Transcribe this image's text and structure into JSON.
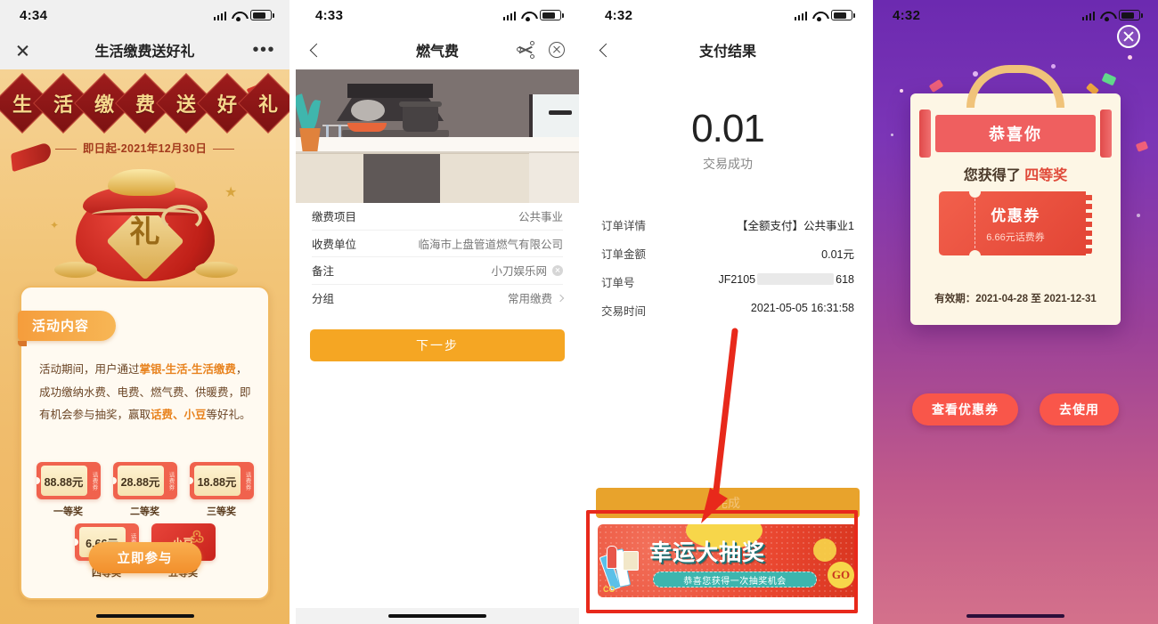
{
  "panel1": {
    "status": {
      "time": "4:34"
    },
    "nav": {
      "title": "生活缴费送好礼",
      "close_icon": "close-icon",
      "more_icon": "more-dots-icon"
    },
    "banner": {
      "headline": "生活缴费送好礼",
      "headline_chars": [
        "生",
        "活",
        "缴",
        "费",
        "送",
        "好",
        "礼"
      ],
      "date_range": "即日起-2021年12月30日",
      "bag_char": "礼"
    },
    "card": {
      "tab_label": "活动内容",
      "desc_1": "活动期间，用户通过",
      "desc_highlight_1": "掌银-生活-生活缴费",
      "desc_2": "，成功缴纳水费、电费、燃气费、供暖费，即有机会参与抽奖，赢取",
      "desc_highlight_2": "话费、小豆",
      "desc_3": "等好礼。",
      "prizes": [
        {
          "amount": "88.88元",
          "side": "话费券",
          "label": "一等奖"
        },
        {
          "amount": "28.88元",
          "side": "话费券",
          "label": "二等奖"
        },
        {
          "amount": "18.88元",
          "side": "话费券",
          "label": "三等奖"
        },
        {
          "amount": "6.66元",
          "side": "话费券",
          "label": "四等奖"
        },
        {
          "amount": "小豆",
          "side": "",
          "label": "五等奖"
        }
      ],
      "join_button": "立即参与"
    }
  },
  "panel2": {
    "status": {
      "time": "4:33"
    },
    "nav": {
      "title": "燃气费",
      "back_icon": "back-chevron-icon",
      "share_icon": "share-icon",
      "close_icon": "close-circle-icon"
    },
    "hero_alt": "kitchen-illustration",
    "rows": [
      {
        "label": "缴费项目",
        "value": "公共事业",
        "type": "text"
      },
      {
        "label": "收费单位",
        "value": "临海市上盘管道燃气有限公司",
        "type": "text"
      },
      {
        "label": "备注",
        "value": "小刀娱乐网",
        "type": "clearable"
      },
      {
        "label": "分组",
        "value": "常用缴费",
        "type": "chevron"
      }
    ],
    "next_button": "下一步"
  },
  "panel3": {
    "status": {
      "time": "4:32"
    },
    "nav": {
      "title": "支付结果",
      "back_icon": "back-chevron-icon"
    },
    "amount": "0.01",
    "amount_status": "交易成功",
    "order_rows": [
      {
        "label": "订单详情",
        "value": "【全额支付】公共事业1"
      },
      {
        "label": "订单金额",
        "value": "0.01元"
      },
      {
        "label": "订单号",
        "value_prefix": "JF2105",
        "value_masked": true,
        "value_suffix": "618"
      },
      {
        "label": "交易时间",
        "value": "2021-05-05 16:31:58"
      }
    ],
    "done_button": "完成",
    "lottery_banner": {
      "title": "幸运大抽奖",
      "subtitle": "恭喜您获得一次抽奖机会",
      "go_label": "GO",
      "tag": "CO"
    },
    "annotations": {
      "highlight_color": "#e8291b",
      "arrow_color": "#e8291b"
    }
  },
  "panel4": {
    "status": {
      "time": "4:32"
    },
    "close_icon": "close-circle-icon",
    "card": {
      "banner_title": "恭喜你",
      "win_prefix": "您获得了",
      "win_prize": "四等奖",
      "ticket_title": "优惠券",
      "ticket_sub": "6.66元话费券",
      "validity": "有效期：2021-04-28 至 2021-12-31"
    },
    "buttons": [
      {
        "label": "查看优惠券"
      },
      {
        "label": "去使用"
      }
    ]
  },
  "colors": {
    "orange": "#f5a623",
    "red": "#e8291b",
    "gold": "#f0c37a",
    "purple": "#6c2ab0",
    "coupon_red": "#f0624d"
  }
}
